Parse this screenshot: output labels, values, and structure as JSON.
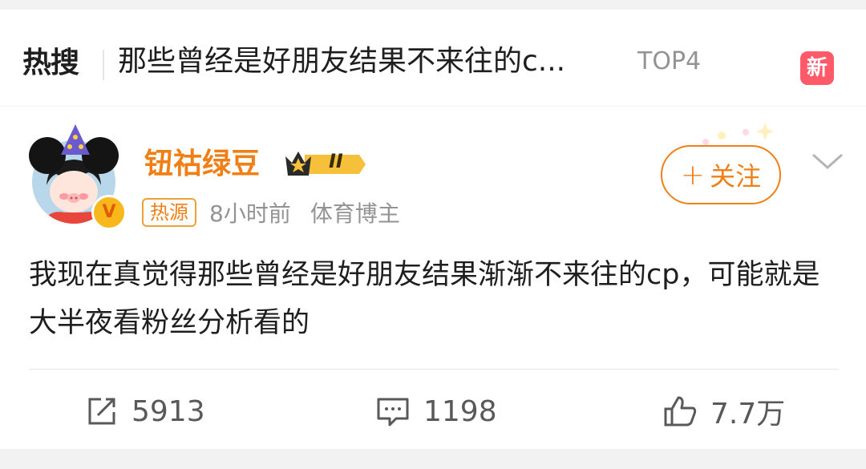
{
  "hot_search": {
    "logo_label": "热搜",
    "topic_title": "那些曾经是好朋友结果不来往的c...",
    "rank": "TOP4",
    "new_badge": "新"
  },
  "post": {
    "username": "钮祜绿豆",
    "level_badge": "II",
    "source_badge": "热源",
    "time": "8小时前",
    "user_type": "体育博主",
    "follow_label": "关注",
    "verified_badge": "V",
    "content": "我现在真觉得那些曾经是好朋友结果渐渐不来往的cp，可能就是大半夜看粉丝分析看的",
    "actions": {
      "repost_count": "5913",
      "comment_count": "1198",
      "like_count": "7.7万"
    }
  },
  "colors": {
    "accent": "#f07f16",
    "new_badge": "#ff5a6a",
    "secondary_text": "#939393"
  },
  "icons": [
    "flame-icon",
    "new-badge",
    "avatar",
    "crown-icon",
    "plus-icon",
    "chevron-down-icon",
    "repost-icon",
    "comment-icon",
    "like-icon"
  ]
}
